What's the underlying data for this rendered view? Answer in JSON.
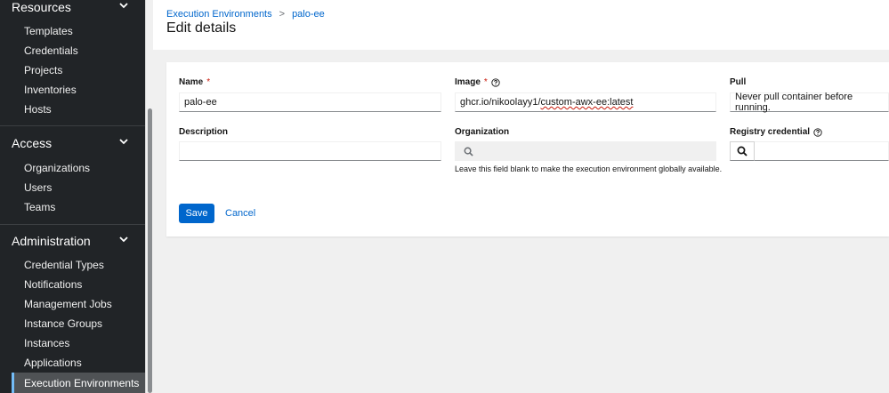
{
  "sidebar": {
    "resources": {
      "header": "Resources",
      "items": [
        "Templates",
        "Credentials",
        "Projects",
        "Inventories",
        "Hosts"
      ]
    },
    "access": {
      "header": "Access",
      "items": [
        "Organizations",
        "Users",
        "Teams"
      ]
    },
    "administration": {
      "header": "Administration",
      "items": [
        "Credential Types",
        "Notifications",
        "Management Jobs",
        "Instance Groups",
        "Instances",
        "Applications",
        "Execution Environments"
      ]
    }
  },
  "breadcrumb": {
    "parent": "Execution Environments",
    "separator": ">",
    "current": "palo-ee"
  },
  "page_title": "Edit details",
  "form": {
    "name": {
      "label": "Name",
      "required": "*",
      "value": "palo-ee"
    },
    "image": {
      "label": "Image",
      "required": "*",
      "value_prefix": "ghcr.io/nikoolayy1/",
      "value_misspelled": "custom-awx-ee:latest"
    },
    "pull": {
      "label": "Pull",
      "value": "Never pull container before running."
    },
    "description": {
      "label": "Description",
      "value": ""
    },
    "organization": {
      "label": "Organization",
      "value": "",
      "helper": "Leave this field blank to make the execution environment globally available."
    },
    "registry_credential": {
      "label": "Registry credential",
      "value": ""
    }
  },
  "actions": {
    "save": "Save",
    "cancel": "Cancel"
  },
  "colors": {
    "sidebar_bg": "#212427",
    "primary": "#0066cc",
    "required": "#c9190b",
    "active_indicator": "#73bcf7"
  }
}
